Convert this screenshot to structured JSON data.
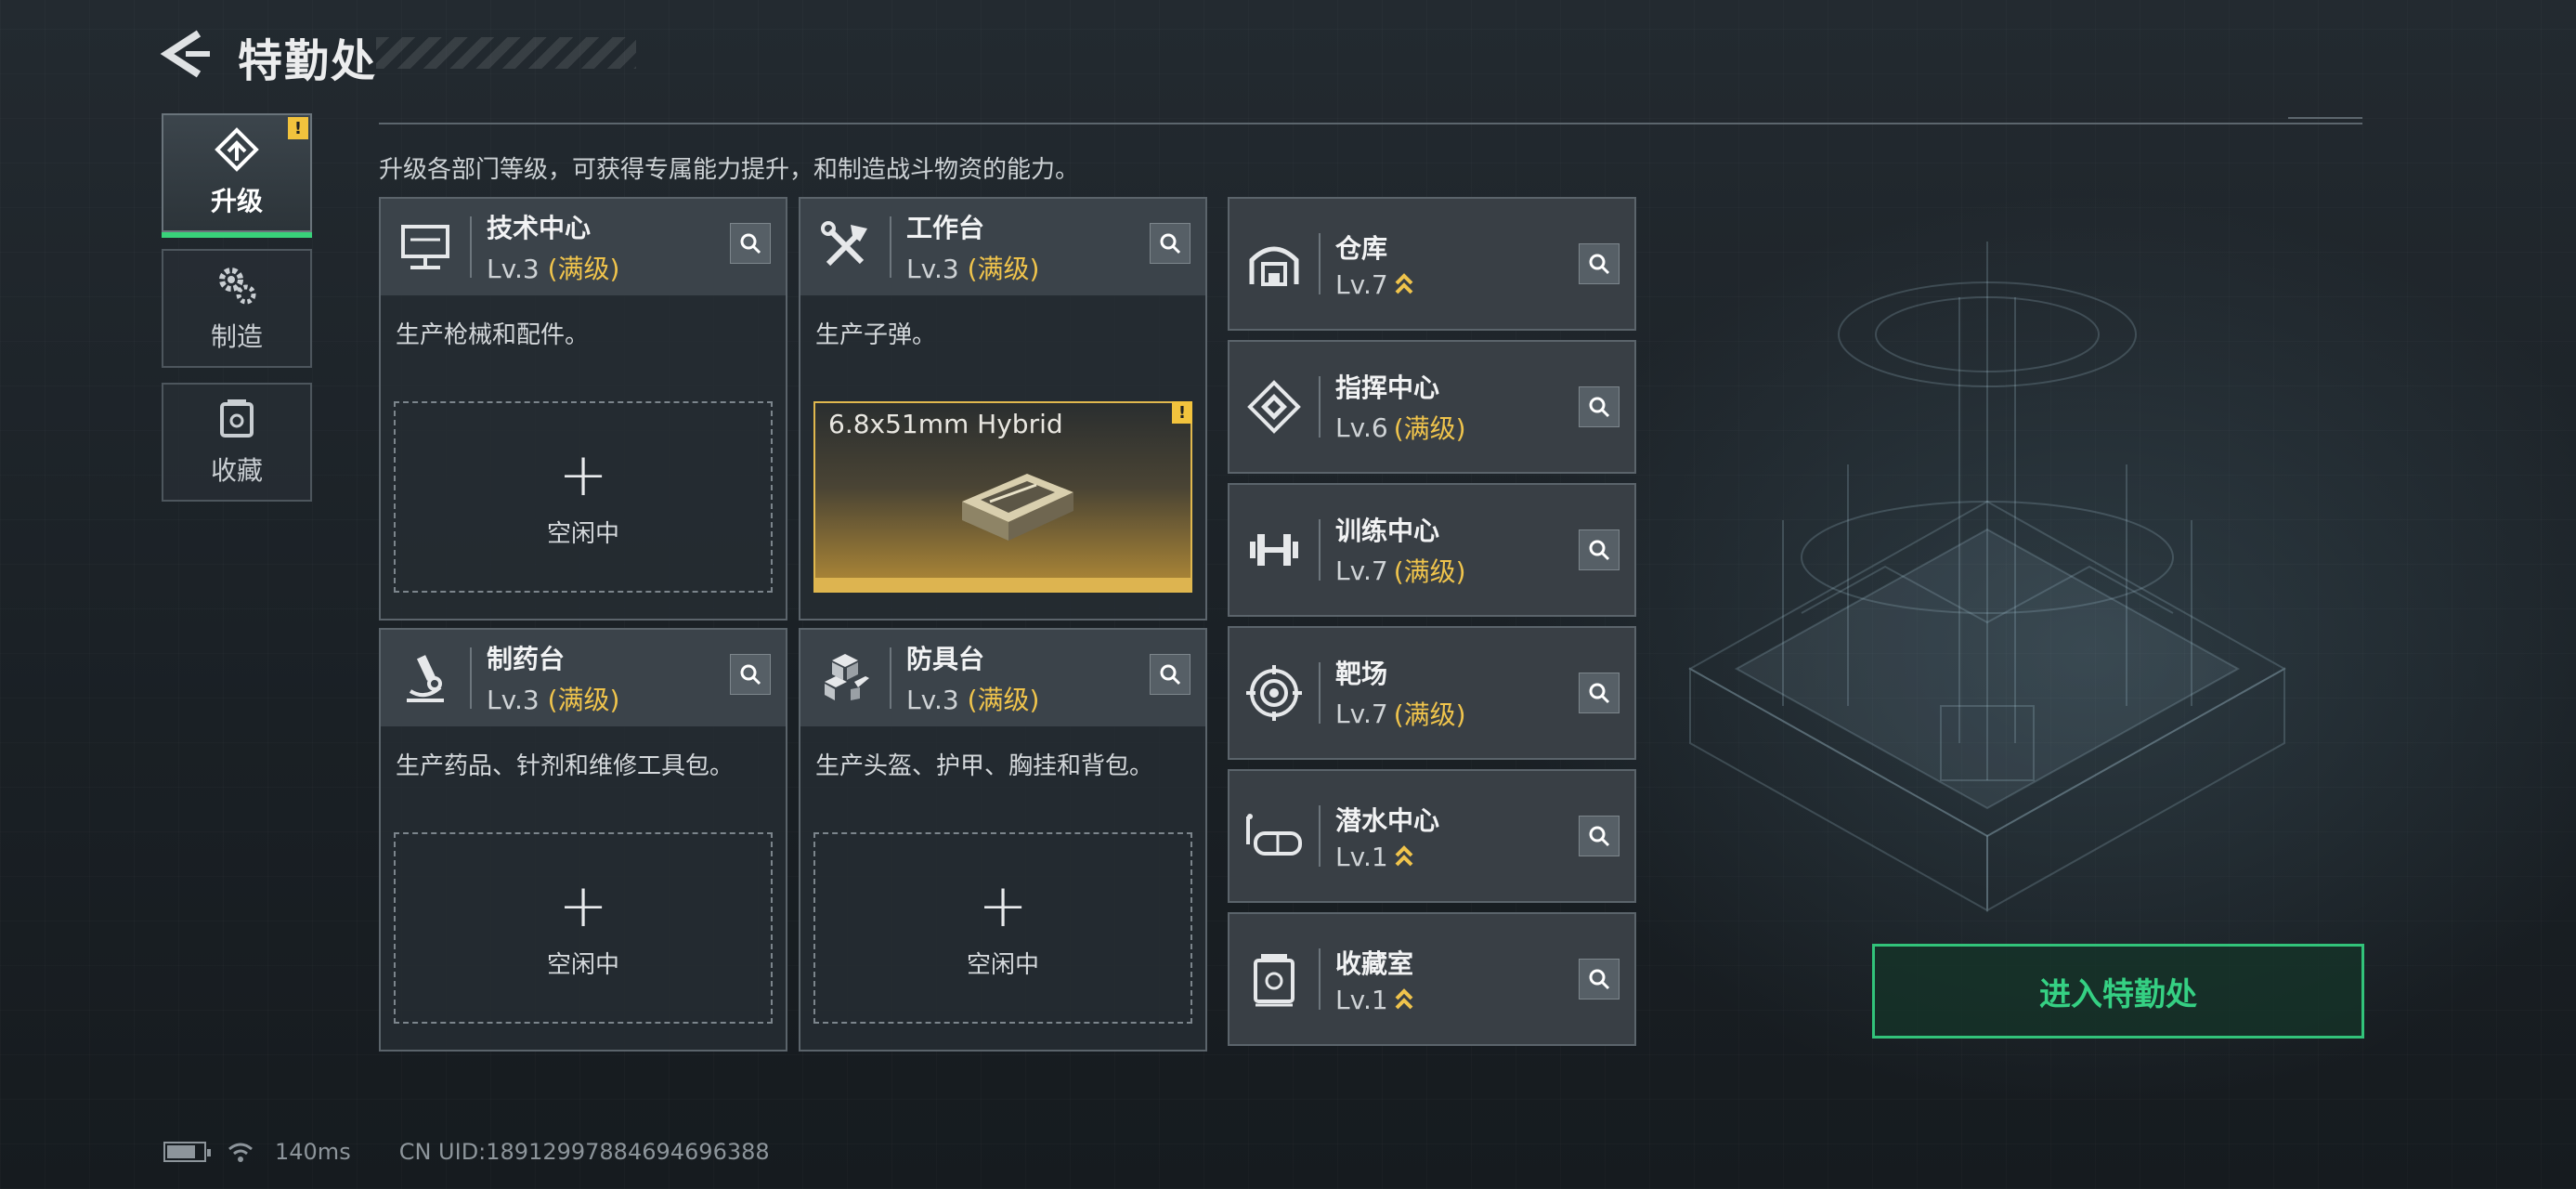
{
  "header": {
    "title": "特勤处"
  },
  "side_tabs": [
    {
      "label": "升级",
      "icon": "upgrade-icon",
      "active": true,
      "warning": "!"
    },
    {
      "label": "制造",
      "icon": "gears-icon",
      "active": false
    },
    {
      "label": "收藏",
      "icon": "collection-icon",
      "active": false
    }
  ],
  "description": "升级各部门等级，可获得专属能力提升，和制造战斗物资的能力。",
  "big_cards": [
    {
      "name": "技术中心",
      "level": "Lv.3",
      "status": "(满级)",
      "icon": "monitor-icon",
      "desc": "生产枪械和配件。",
      "slot": {
        "plus": "+",
        "label": "空闲中"
      }
    },
    {
      "name": "工作台",
      "level": "Lv.3",
      "status": "(满级)",
      "icon": "tools-icon",
      "desc": "生产子弹。",
      "craft": {
        "item": "6.8x51mm Hybrid",
        "warning": "!"
      }
    },
    {
      "name": "制药台",
      "level": "Lv.3",
      "status": "(满级)",
      "icon": "microscope-icon",
      "desc": "生产药品、针剂和维修工具包。",
      "slot": {
        "plus": "+",
        "label": "空闲中"
      }
    },
    {
      "name": "防具台",
      "level": "Lv.3",
      "status": "(满级)",
      "icon": "cubes-icon",
      "desc": "生产头盔、护甲、胸挂和背包。",
      "slot": {
        "plus": "+",
        "label": "空闲中"
      }
    }
  ],
  "small_cards": [
    {
      "name": "仓库",
      "level": "Lv.7",
      "status": "",
      "upgradable": true,
      "icon": "warehouse-icon"
    },
    {
      "name": "指挥中心",
      "level": "Lv.6",
      "status": "(满级)",
      "upgradable": false,
      "icon": "command-icon"
    },
    {
      "name": "训练中心",
      "level": "Lv.7",
      "status": "(满级)",
      "upgradable": false,
      "icon": "dumbbell-icon"
    },
    {
      "name": "靶场",
      "level": "Lv.7",
      "status": "(满级)",
      "upgradable": false,
      "icon": "target-icon"
    },
    {
      "name": "潜水中心",
      "level": "Lv.1",
      "status": "",
      "upgradable": true,
      "icon": "diving-mask-icon"
    },
    {
      "name": "收藏室",
      "level": "Lv.1",
      "status": "",
      "upgradable": true,
      "icon": "collection-icon"
    }
  ],
  "enter_button": "进入特勤处",
  "status_bar": {
    "ping": "140ms",
    "uid": "CN UID:18912997884694696388"
  },
  "colors": {
    "accent_green": "#35d083",
    "max_gold": "#f0c44c",
    "warning_yellow": "#f2c33d"
  }
}
